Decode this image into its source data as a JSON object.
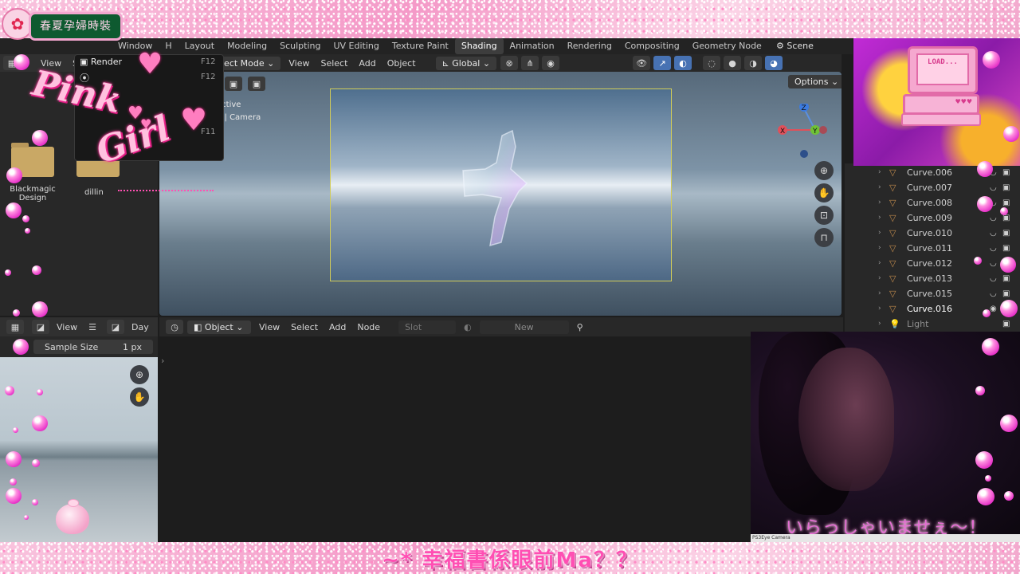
{
  "overlay": {
    "badge_text": "春夏孕婦時裝",
    "pink_word_1": "Pink",
    "pink_word_2": "Girl",
    "retro_screen": "LOAD...",
    "retro_hearts": "♥♥♥",
    "webcam_caption": "いらっしゃいませぇ〜！",
    "webcam_label": "PS3Eye Camera",
    "marquee": "~* 幸福書係眼前Ma？？"
  },
  "topbar": {
    "workspaces": [
      "Window",
      "H",
      "Layout",
      "Modeling",
      "Sculpting",
      "UV Editing",
      "Texture Paint",
      "Shading",
      "Animation",
      "Rendering",
      "Compositing",
      "Geometry Node"
    ],
    "active": "Shading",
    "scene": "Scene"
  },
  "file_browser": {
    "view": "View",
    "s": "S",
    "folder_label_1": "Blackmagic",
    "folder_label_2": "Design",
    "folder2_label": "dillin"
  },
  "menu": {
    "item_render": "Render",
    "shortcut_1": "F12",
    "shortcut_2": "F12",
    "shortcut_3": "F11"
  },
  "viewport_header": {
    "mode": "ject Mode",
    "view": "View",
    "select": "Select",
    "add": "Add",
    "object": "Object",
    "orientation": "Global",
    "options": "Options"
  },
  "viewport": {
    "overlay_line1": "ective",
    "overlay_line2": "n | Camera"
  },
  "image_editor": {
    "view": "View",
    "day": "Day",
    "sample_size_label": "Sample Size",
    "sample_size_value": "1 px"
  },
  "node_editor": {
    "object": "Object",
    "view": "View",
    "select": "Select",
    "add": "Add",
    "node": "Node",
    "slot": "Slot",
    "new": "New"
  },
  "outliner": {
    "items": [
      {
        "label": "Curve.006",
        "type": "curve"
      },
      {
        "label": "Curve.007",
        "type": "curve"
      },
      {
        "label": "Curve.008",
        "type": "curve"
      },
      {
        "label": "Curve.009",
        "type": "curve"
      },
      {
        "label": "Curve.010",
        "type": "curve"
      },
      {
        "label": "Curve.011",
        "type": "curve"
      },
      {
        "label": "Curve.012",
        "type": "curve"
      },
      {
        "label": "Curve.013",
        "type": "curve"
      },
      {
        "label": "Curve.015",
        "type": "curve"
      },
      {
        "label": "Curve.016",
        "type": "curve",
        "selected": true
      },
      {
        "label": "Light",
        "type": "light"
      }
    ]
  },
  "colors": {
    "accent": "#4772b3",
    "camera_frame": "#d2cc58",
    "curve_icon": "#c18a4c",
    "pink": "#ff4fb3"
  }
}
